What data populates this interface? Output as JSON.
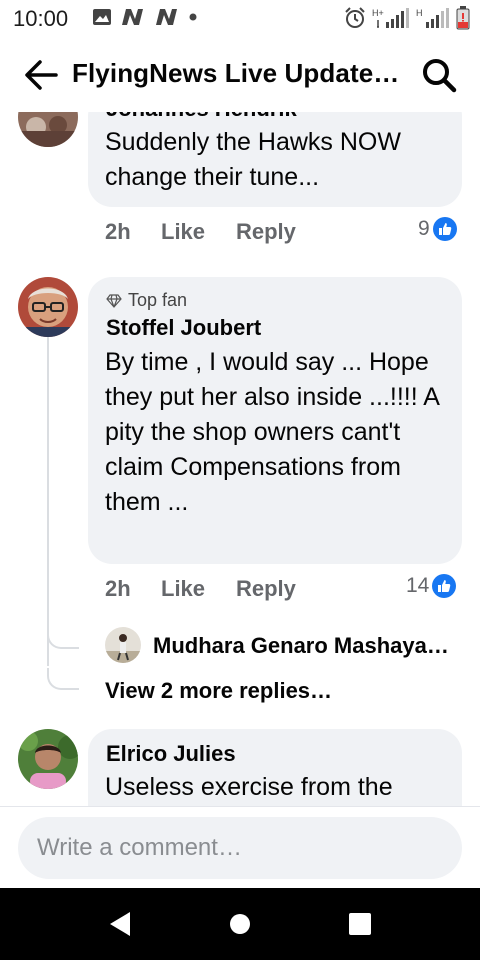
{
  "status_bar": {
    "time": "10:00",
    "icons_left": [
      "gallery-icon",
      "n-notification-icon",
      "n-notification-icon",
      "dot-icon"
    ],
    "icons_right": [
      "alarm-icon",
      "signal-hplus-icon",
      "signal-h-icon",
      "battery-low-icon"
    ],
    "net_label_1": "H+",
    "net_label_2": "H"
  },
  "header": {
    "title": "FlyingNews Live Update…",
    "back_icon": "back-arrow-icon",
    "search_icon": "search-icon"
  },
  "comments": [
    {
      "author": "Johannes Hendrik",
      "text": "Suddenly the Hawks NOW change their tune...",
      "time": "2h",
      "like_label": "Like",
      "reply_label": "Reply",
      "reaction_count": "9"
    },
    {
      "badge": "Top fan",
      "author": "Stoffel Joubert",
      "text": "By time , I would say ... Hope they put her also inside ...!!!! A pity the shop owners cant't claim Compensations from them ...",
      "time": "2h",
      "like_label": "Like",
      "reply_label": "Reply",
      "reaction_count": "14",
      "reply_preview_author": "Mudhara Genaro Mashaya…",
      "more_replies": "View 2 more replies…"
    },
    {
      "author": "Elrico Julies",
      "text": "Useless exercise from the"
    }
  ],
  "composer": {
    "placeholder": "Write a comment…"
  },
  "nav": {
    "back": "triangle-back-icon",
    "home": "circle-home-icon",
    "recents": "square-recents-icon"
  },
  "colors": {
    "accent": "#1877f2",
    "bubble": "#f0f2f5",
    "meta_text": "#65676b",
    "battery_low": "#e53935"
  }
}
